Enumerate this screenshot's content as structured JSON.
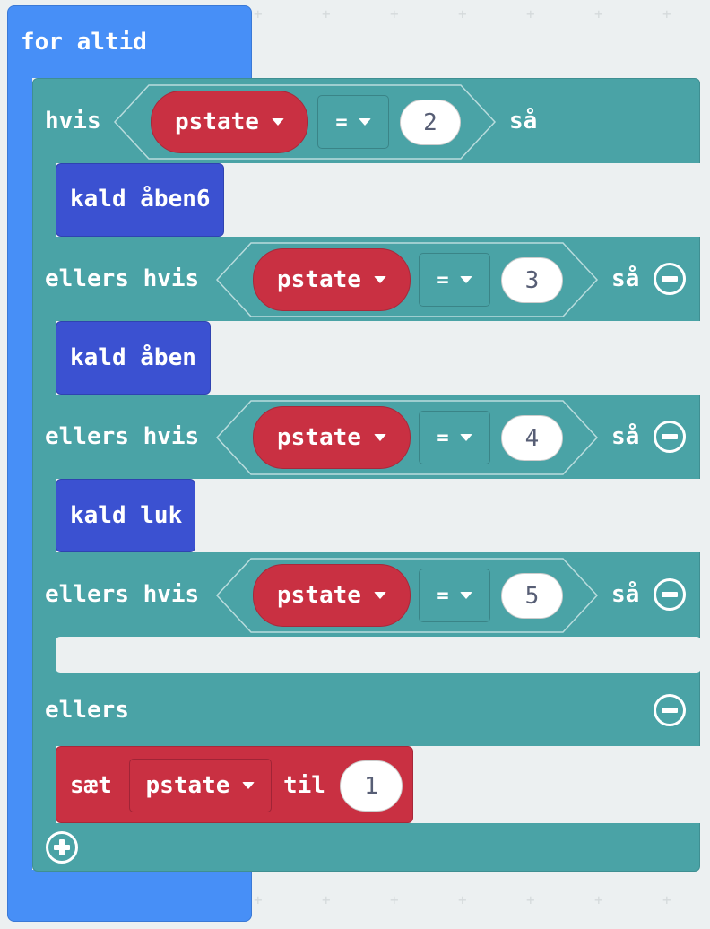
{
  "forever": {
    "label": "for altid"
  },
  "if_block": {
    "if_label": "hvis",
    "then_label": "så",
    "elseif_label": "ellers hvis",
    "else_label": "ellers",
    "variable": "pstate",
    "operator": "=",
    "branches": [
      {
        "value": "2",
        "call": "kald åben6"
      },
      {
        "value": "3",
        "call": "kald åben"
      },
      {
        "value": "4",
        "call": "kald luk"
      },
      {
        "value": "5",
        "call": ""
      }
    ],
    "else_body": {
      "set_label": "sæt",
      "variable": "pstate",
      "to_label": "til",
      "value": "1"
    }
  },
  "icons": {
    "remove": "minus-circle-icon",
    "add": "plus-circle-icon",
    "dropdown": "dropdown-triangle-icon"
  },
  "colors": {
    "forever": "#478ff7",
    "logic": "#4aa3a6",
    "variable": "#c93042",
    "function": "#3b51d1",
    "workspace": "#ecf0f1"
  }
}
